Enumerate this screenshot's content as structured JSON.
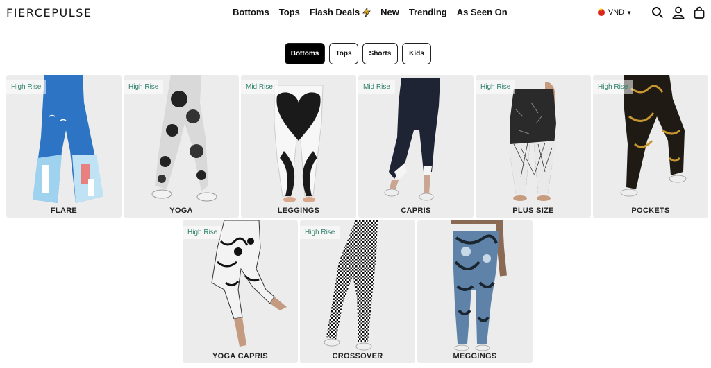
{
  "brand": {
    "logo_text": "FIERCEPULSE"
  },
  "nav": {
    "items": [
      {
        "label": "Bottoms"
      },
      {
        "label": "Tops"
      },
      {
        "label": "Flash Deals"
      },
      {
        "label": "New"
      },
      {
        "label": "Trending"
      },
      {
        "label": "As Seen On"
      }
    ]
  },
  "header": {
    "currency": "VND",
    "icons": [
      "search-icon",
      "account-icon",
      "cart-icon"
    ]
  },
  "category_tabs": {
    "active": "Bottoms",
    "items": [
      {
        "label": "Bottoms"
      },
      {
        "label": "Tops"
      },
      {
        "label": "Shorts"
      },
      {
        "label": "Kids"
      }
    ]
  },
  "products": [
    {
      "title": "FLARE",
      "badge": "High Rise"
    },
    {
      "title": "YOGA",
      "badge": "High Rise"
    },
    {
      "title": "LEGGINGS",
      "badge": "Mid Rise"
    },
    {
      "title": "CAPRIS",
      "badge": "Mid Rise"
    },
    {
      "title": "PLUS SIZE",
      "badge": "High Rise"
    },
    {
      "title": "POCKETS",
      "badge": "High Rise"
    },
    {
      "title": "YOGA CAPRIS",
      "badge": "High Rise"
    },
    {
      "title": "CROSSOVER",
      "badge": "High Rise"
    },
    {
      "title": "MEGGINGS",
      "badge": ""
    }
  ],
  "colors": {
    "badge_text": "#2f7f6a",
    "card_bg": "#ececec",
    "active_pill": "#000000",
    "flash_bolt": "#f5b301"
  }
}
